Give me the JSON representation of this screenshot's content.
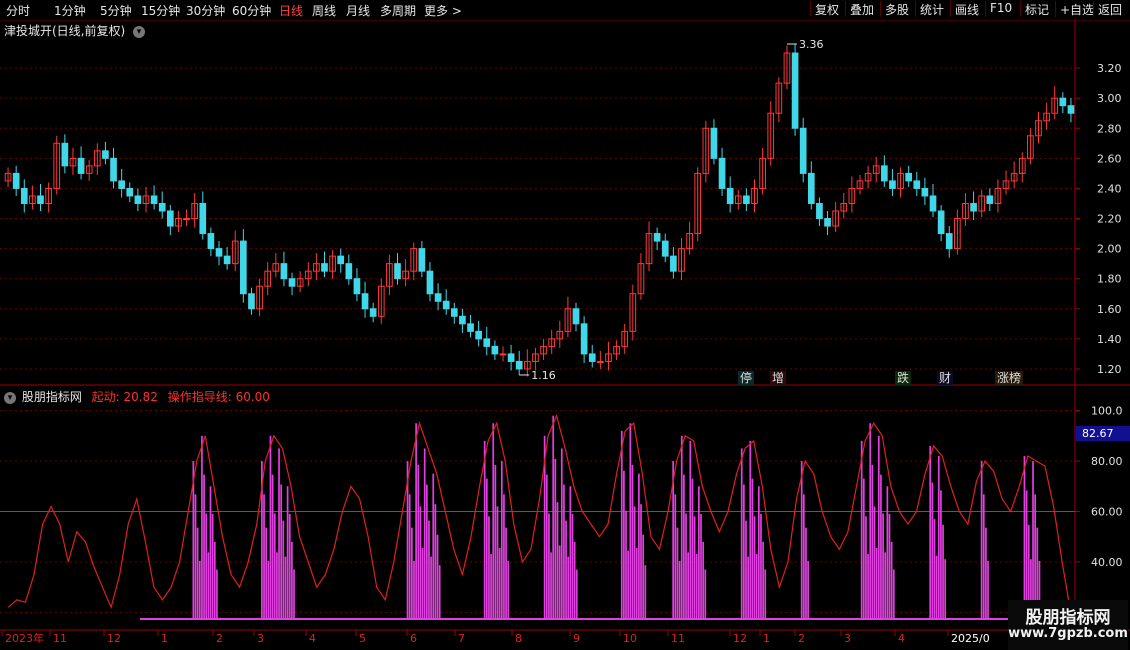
{
  "toolbar": {
    "periods": [
      "分时",
      "1分钟",
      "5分钟",
      "15分钟",
      "30分钟",
      "60分钟",
      "日线",
      "周线",
      "月线",
      "多周期",
      "更多 >"
    ],
    "active_period": "日线",
    "buttons": [
      "复权",
      "叠加",
      "多股",
      "统计",
      "画线",
      "F10",
      "标记",
      "+自选",
      "返回"
    ]
  },
  "main_chart": {
    "title": "津投城开(日线,前复权)",
    "high_label": "3.36",
    "low_label": "1.16",
    "y_ticks": [
      "3.20",
      "3.00",
      "2.80",
      "2.60",
      "2.40",
      "2.20",
      "2.00",
      "1.80",
      "1.60",
      "1.40",
      "1.20"
    ],
    "y_range": [
      1.1,
      3.4
    ],
    "badges": [
      {
        "text": "停",
        "color": "#40d0e0"
      },
      {
        "text": "增",
        "color": "#ff5050"
      },
      {
        "text": "跌",
        "color": "#30e030"
      },
      {
        "text": "财",
        "color": "#6080ff"
      },
      {
        "text": "涨榜",
        "color": "#ff8040"
      }
    ]
  },
  "indicator": {
    "name": "股朋指标网",
    "param1": "起动: 20.82",
    "param2": "操作指导线: 60.00",
    "y_ticks": [
      "100.0",
      "80.00",
      "60.00",
      "40.00",
      "20.00"
    ],
    "last_value": "82.67"
  },
  "x_axis": {
    "labels": [
      "2023年",
      "11",
      "12",
      "1",
      "2",
      "3",
      "4",
      "5",
      "6",
      "7",
      "8",
      "9",
      "10",
      "11",
      "12",
      "1",
      "2",
      "3",
      "4",
      "2025/0"
    ]
  },
  "watermark": {
    "line1": "股朋指标网",
    "line2": "www.7gpzb.com"
  },
  "chart_data": {
    "type": "line",
    "title": "津投城开(日线,前复权)",
    "price_ylim": [
      1.1,
      3.4
    ],
    "price_series": [
      2.5,
      2.4,
      2.3,
      2.35,
      2.3,
      2.4,
      2.7,
      2.55,
      2.6,
      2.5,
      2.55,
      2.65,
      2.6,
      2.45,
      2.4,
      2.35,
      2.3,
      2.35,
      2.3,
      2.25,
      2.15,
      2.2,
      2.2,
      2.3,
      2.1,
      2.0,
      1.95,
      1.9,
      2.05,
      1.7,
      1.6,
      1.75,
      1.85,
      1.9,
      1.8,
      1.75,
      1.8,
      1.85,
      1.9,
      1.85,
      1.95,
      1.9,
      1.8,
      1.7,
      1.6,
      1.55,
      1.75,
      1.9,
      1.8,
      1.85,
      2.0,
      1.85,
      1.7,
      1.65,
      1.6,
      1.55,
      1.5,
      1.45,
      1.4,
      1.35,
      1.3,
      1.3,
      1.25,
      1.2,
      1.25,
      1.3,
      1.35,
      1.4,
      1.45,
      1.6,
      1.5,
      1.3,
      1.25,
      1.25,
      1.3,
      1.35,
      1.45,
      1.7,
      1.9,
      2.1,
      2.05,
      1.95,
      1.85,
      2.0,
      2.1,
      2.5,
      2.8,
      2.6,
      2.4,
      2.3,
      2.35,
      2.3,
      2.4,
      2.6,
      2.9,
      3.1,
      3.3,
      2.8,
      2.5,
      2.3,
      2.2,
      2.15,
      2.25,
      2.3,
      2.4,
      2.45,
      2.5,
      2.55,
      2.45,
      2.4,
      2.5,
      2.45,
      2.4,
      2.35,
      2.25,
      2.1,
      2.0,
      2.2,
      2.3,
      2.25,
      2.35,
      2.3,
      2.4,
      2.45,
      2.5,
      2.6,
      2.75,
      2.85,
      2.9,
      3.0,
      2.95,
      2.9
    ],
    "indicator_ylim": [
      15,
      105
    ],
    "reference_line": 60,
    "indicator_series": [
      22,
      25,
      24,
      35,
      55,
      62,
      55,
      40,
      52,
      48,
      38,
      30,
      22,
      35,
      55,
      65,
      48,
      30,
      25,
      30,
      40,
      60,
      80,
      90,
      70,
      50,
      35,
      30,
      40,
      55,
      80,
      90,
      85,
      70,
      50,
      40,
      30,
      35,
      45,
      60,
      70,
      65,
      50,
      30,
      25,
      40,
      60,
      80,
      95,
      85,
      75,
      60,
      45,
      35,
      50,
      70,
      88,
      95,
      80,
      55,
      40,
      45,
      65,
      90,
      98,
      85,
      70,
      60,
      55,
      50,
      55,
      75,
      92,
      95,
      75,
      50,
      45,
      60,
      80,
      90,
      88,
      70,
      60,
      52,
      60,
      75,
      85,
      88,
      70,
      45,
      30,
      40,
      65,
      80,
      75,
      60,
      50,
      45,
      52,
      70,
      88,
      95,
      90,
      70,
      60,
      55,
      60,
      75,
      86,
      82,
      70,
      60,
      55,
      72,
      80,
      76,
      65,
      60,
      70,
      82,
      80,
      78,
      62,
      40,
      20
    ]
  }
}
